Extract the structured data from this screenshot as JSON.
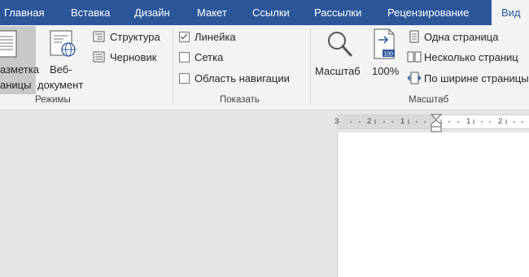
{
  "tabs": [
    {
      "label": "Главная"
    },
    {
      "label": "Вставка"
    },
    {
      "label": "Дизайн"
    },
    {
      "label": "Макет"
    },
    {
      "label": "Ссылки"
    },
    {
      "label": "Рассылки"
    },
    {
      "label": "Рецензирование"
    },
    {
      "label": "Вид",
      "active": true
    }
  ],
  "groups": {
    "modes": {
      "label": "Режимы",
      "layout_line1": "азметка",
      "layout_line2": "аницы",
      "web_line1": "Веб-",
      "web_line2": "документ",
      "outline": "Структура",
      "draft": "Черновик"
    },
    "show": {
      "label": "Показать",
      "ruler": {
        "label": "Линейка",
        "checked": true
      },
      "grid": {
        "label": "Сетка",
        "checked": false
      },
      "nav": {
        "label": "Область навигации",
        "checked": false
      }
    },
    "zoom": {
      "label": "Масштаб",
      "zoom_button": "Масштаб",
      "percent_button": "100%",
      "percent_icon_text": "100",
      "one_page": "Одна страница",
      "multi_page": "Несколько страниц",
      "page_width": "По ширине страницы"
    }
  },
  "ruler": {
    "ticks": [
      "3",
      "2",
      "1",
      "1",
      "2"
    ]
  },
  "colors": {
    "tabbar": "#2b579a",
    "ribbon": "#f3f3f3",
    "workspace": "#e6e6e6",
    "selected_button": "#c8c8c8",
    "accent": "#2b579a"
  }
}
